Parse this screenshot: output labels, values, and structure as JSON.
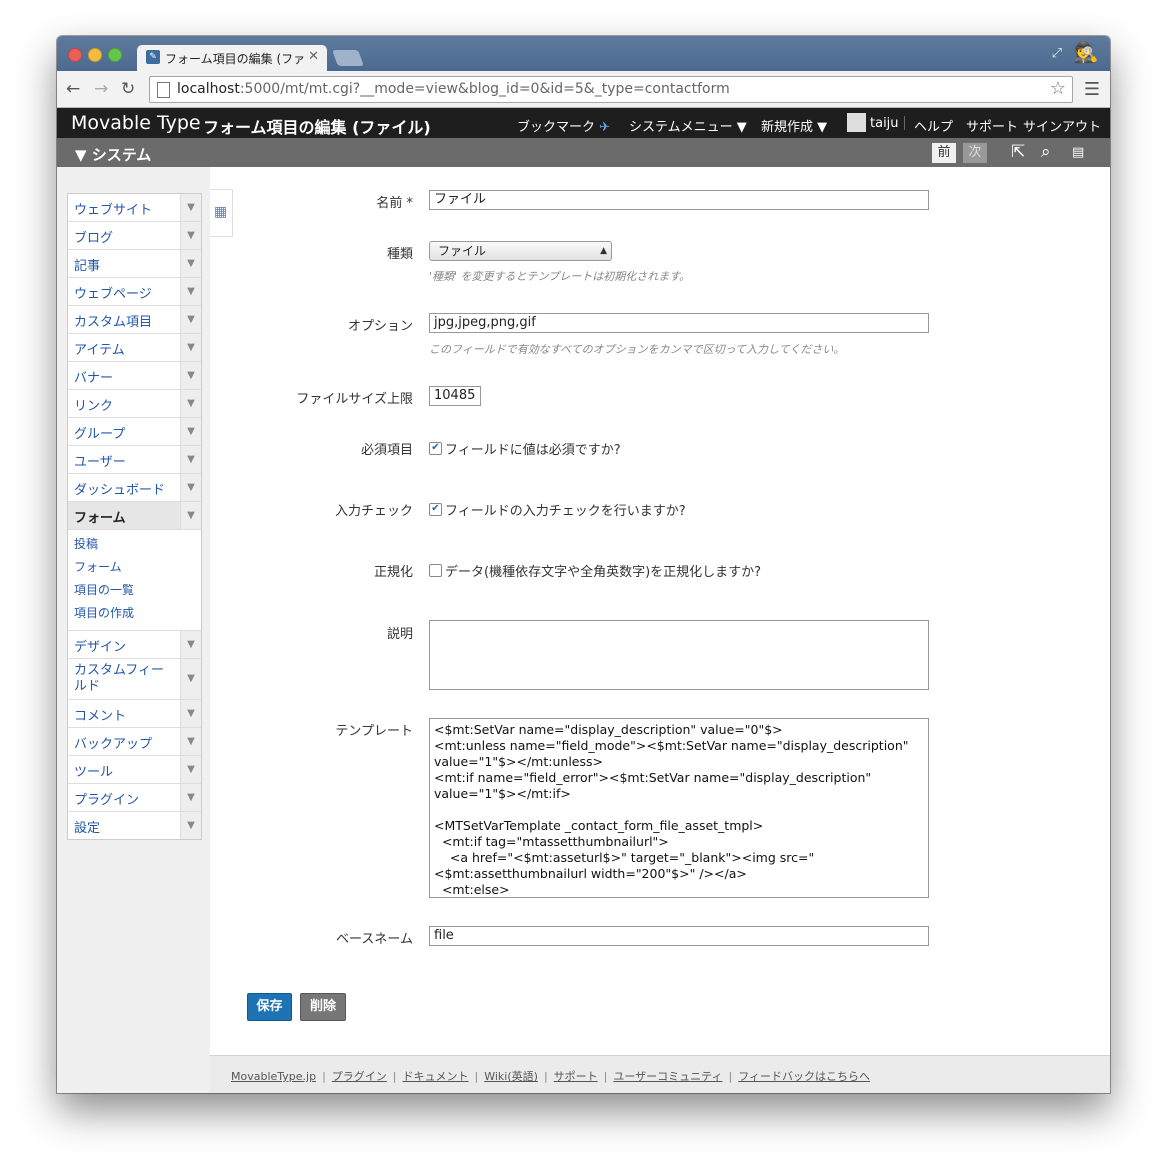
{
  "browser": {
    "tab_title": "フォーム項目の編集 (ファイル)",
    "url_host": "localhost",
    "url_rest": ":5000/mt/mt.cgi?__mode=view&blog_id=0&id=5&_type=contactform"
  },
  "header": {
    "logo": "Movable Type",
    "page_title": "フォーム項目の編集 (ファイル)",
    "nav": {
      "bookmark": "ブックマーク",
      "system_menu": "システムメニュー ▼",
      "new": "新規作成 ▼",
      "user": "taiju",
      "help": "ヘルプ",
      "support": "サポート",
      "signout": "サインアウト"
    }
  },
  "scopebar": {
    "title": "▼ システム",
    "prev": "前",
    "next": "次"
  },
  "sidebar": {
    "items": [
      {
        "label": "ウェブサイト"
      },
      {
        "label": "ブログ"
      },
      {
        "label": "記事"
      },
      {
        "label": "ウェブページ"
      },
      {
        "label": "カスタム項目"
      },
      {
        "label": "アイテム"
      },
      {
        "label": "バナー"
      },
      {
        "label": "リンク"
      },
      {
        "label": "グループ"
      },
      {
        "label": "ユーザー"
      },
      {
        "label": "ダッシュボード"
      },
      {
        "label": "フォーム"
      }
    ],
    "form_sub": [
      "投稿",
      "フォーム",
      "項目の一覧",
      "項目の作成"
    ],
    "items_after": [
      {
        "label": "デザイン"
      },
      {
        "label": "カスタムフィールド"
      },
      {
        "label": "コメント"
      },
      {
        "label": "バックアップ"
      },
      {
        "label": "ツール"
      },
      {
        "label": "プラグイン"
      },
      {
        "label": "設定"
      }
    ]
  },
  "form": {
    "name_label": "名前 *",
    "name_value": "ファイル",
    "type_label": "種類",
    "type_value": "ファイル",
    "type_hint": "'種類' を変更するとテンプレートは初期化されます。",
    "options_label": "オプション",
    "options_value": "jpg,jpeg,png,gif",
    "options_hint": "このフィールドで有効なすべてのオプションをカンマで区切って入力してください。",
    "filesize_label": "ファイルサイズ上限",
    "filesize_value": "10485",
    "required_label": "必須項目",
    "required_text": "フィールドに値は必須ですか?",
    "check_label": "入力チェック",
    "check_text": "フィールドの入力チェックを行いますか?",
    "normalize_label": "正規化",
    "normalize_text": "データ(機種依存文字や全角英数字)を正規化しますか?",
    "desc_label": "説明",
    "desc_value": "",
    "template_label": "テンプレート",
    "template_value": "<$mt:SetVar name=\"display_description\" value=\"0\"$>\n<mt:unless name=\"field_mode\"><$mt:SetVar name=\"display_description\" value=\"1\"$></mt:unless>\n<mt:if name=\"field_error\"><$mt:SetVar name=\"display_description\" value=\"1\"$></mt:if>\n\n<MTSetVarTemplate _contact_form_file_asset_tmpl>\n  <mt:if tag=\"mtassetthumbnailurl\">\n    <a href=\"<$mt:asseturl$>\" target=\"_blank\"><img src=\"<$mt:assetthumbnailurl width=\"200\"$>\" /></a>\n  <mt:else>",
    "basename_label": "ベースネーム",
    "basename_value": "file",
    "save_label": "保存",
    "delete_label": "削除"
  },
  "footer": {
    "links": [
      "MovableType.jp",
      "プラグイン",
      "ドキュメント",
      "Wiki(英語)",
      "サポート",
      "ユーザーコミュニティ",
      "フィードバックはこちらへ"
    ]
  }
}
